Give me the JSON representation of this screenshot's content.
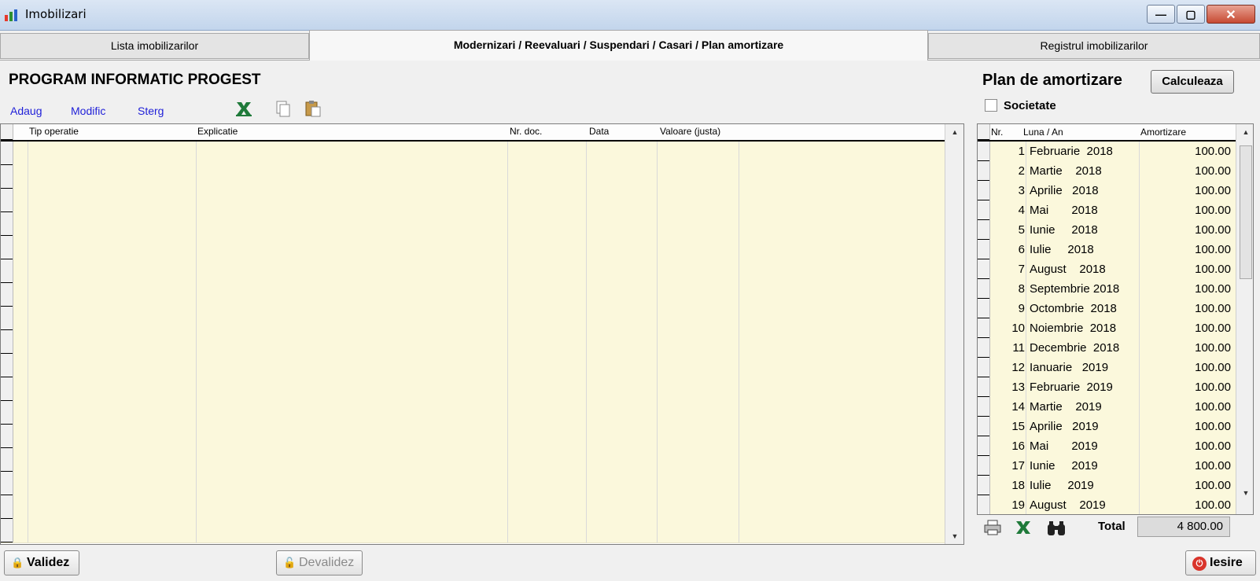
{
  "window": {
    "title": "Imobilizari",
    "minimize_glyph": "—",
    "maximize_glyph": "▢",
    "close_glyph": "✕"
  },
  "tabs": [
    {
      "label": "Lista imobilizarilor",
      "active": false
    },
    {
      "label": "Modernizari / Reevaluari / Suspendari / Casari / Plan amortizare",
      "active": true
    },
    {
      "label": "Registrul imobilizarilor",
      "active": false
    }
  ],
  "company": "PROGRAM INFORMATIC PROGEST",
  "toolbar": {
    "add": "Adaug",
    "edit": "Modific",
    "delete": "Sterg",
    "icons": [
      "excel-icon",
      "copy-icon",
      "paste-icon"
    ]
  },
  "operations_grid": {
    "columns": [
      "Tip operatie",
      "Explicatie",
      "Nr. doc.",
      "Data",
      "Valoare (justa)"
    ],
    "rows": []
  },
  "plan": {
    "title": "Plan de amortizare",
    "calculate_label": "Calculeaza",
    "society_label": "Societate",
    "society_checked": false,
    "columns": [
      "Nr.",
      "Luna / An",
      "Amortizare"
    ],
    "rows": [
      {
        "nr": "1",
        "luna": "Februarie  2018",
        "amortizare": "100.00"
      },
      {
        "nr": "2",
        "luna": "Martie    2018",
        "amortizare": "100.00"
      },
      {
        "nr": "3",
        "luna": "Aprilie   2018",
        "amortizare": "100.00"
      },
      {
        "nr": "4",
        "luna": "Mai       2018",
        "amortizare": "100.00"
      },
      {
        "nr": "5",
        "luna": "Iunie     2018",
        "amortizare": "100.00"
      },
      {
        "nr": "6",
        "luna": "Iulie     2018",
        "amortizare": "100.00"
      },
      {
        "nr": "7",
        "luna": "August    2018",
        "amortizare": "100.00"
      },
      {
        "nr": "8",
        "luna": "Septembrie 2018",
        "amortizare": "100.00"
      },
      {
        "nr": "9",
        "luna": "Octombrie  2018",
        "amortizare": "100.00"
      },
      {
        "nr": "10",
        "luna": "Noiembrie  2018",
        "amortizare": "100.00"
      },
      {
        "nr": "11",
        "luna": "Decembrie  2018",
        "amortizare": "100.00"
      },
      {
        "nr": "12",
        "luna": "Ianuarie   2019",
        "amortizare": "100.00"
      },
      {
        "nr": "13",
        "luna": "Februarie  2019",
        "amortizare": "100.00"
      },
      {
        "nr": "14",
        "luna": "Martie    2019",
        "amortizare": "100.00"
      },
      {
        "nr": "15",
        "luna": "Aprilie   2019",
        "amortizare": "100.00"
      },
      {
        "nr": "16",
        "luna": "Mai       2019",
        "amortizare": "100.00"
      },
      {
        "nr": "17",
        "luna": "Iunie     2019",
        "amortizare": "100.00"
      },
      {
        "nr": "18",
        "luna": "Iulie     2019",
        "amortizare": "100.00"
      },
      {
        "nr": "19",
        "luna": "August    2019",
        "amortizare": "100.00"
      }
    ],
    "total_label": "Total",
    "total_value": "4 800.00",
    "footer_icons": [
      "print-icon",
      "excel-icon",
      "binoculars-icon"
    ]
  },
  "buttons": {
    "validate": "Validez",
    "invalidate": "Devalidez",
    "exit": "Iesire"
  },
  "colors": {
    "row_bg": "#fbf8dc",
    "link": "#1f1fd8",
    "exit_icon": "#d9342b"
  }
}
